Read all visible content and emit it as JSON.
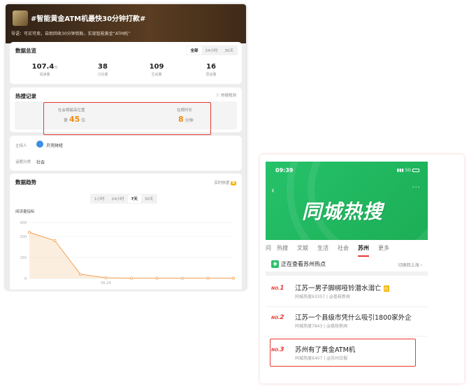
{
  "left_panel": {
    "header": {
      "title": "#智能黄金ATM机最快30分钟打款#",
      "lead": "导语：可买可卖，自助回收30分钟到账，实现智能黄金“ATM机”"
    },
    "overview": {
      "title": "数据总览",
      "ranges": [
        "全部",
        "24小时",
        "30天"
      ],
      "active_range": "全部",
      "stats": [
        {
          "value": "107.4",
          "unit": "万",
          "label": "阅读量"
        },
        {
          "value": "38",
          "unit": "",
          "label": "讨论量"
        },
        {
          "value": "109",
          "unit": "",
          "label": "互动量"
        },
        {
          "value": "16",
          "unit": "",
          "label": "原创量"
        }
      ]
    },
    "hot_record": {
      "title": "热搜记录",
      "rule_link": "热搜规则",
      "position_label": "社会榜最高位置",
      "position_prefix": "第",
      "position_value": "45",
      "position_suffix": "位",
      "duration_label": "在榜时长",
      "duration_value": "8",
      "duration_unit": "分钟"
    },
    "info": {
      "host_label": "主持人",
      "host_name": "贝壳财经",
      "category_label": "话题分类",
      "category_value": "社会"
    },
    "trend": {
      "title": "数据趋势",
      "realtime_label": "实时热度",
      "realtime_value": "0",
      "ranges": [
        "1小时",
        "24小时",
        "7天",
        "30天"
      ],
      "active_range": "7天",
      "metric_label": "阅读量指标",
      "chart_data": {
        "type": "area",
        "ylim": [
          0,
          400
        ],
        "yticks": [
          "400",
          "300",
          "150",
          "0"
        ],
        "x_label": "06-24",
        "values": [
          330,
          270,
          30,
          5,
          2,
          2,
          2,
          2,
          2
        ],
        "color": "#f0a050"
      }
    }
  },
  "right_panel": {
    "status_time": "09:39",
    "status_signal": "5G",
    "banner_title": "同城热搜",
    "back_icon": "back-chevron-icon",
    "more_icon": "more-dots-icon",
    "tabs": [
      "问",
      "热搜",
      "文娱",
      "生活",
      "社会",
      "苏州",
      "更多"
    ],
    "active_tab": "苏州",
    "viewing_text": "正在查看苏州热点",
    "switch_text": "切换回上海",
    "items": [
      {
        "rank": "1",
        "title": "江苏一男子脚绑哑铃潜水溺亡",
        "badge": "热",
        "meta": "同城热度63357 | @荔枝新闻"
      },
      {
        "rank": "2",
        "title": "江苏一个县级市凭什么吸引1800家外企",
        "meta": "同城热度7843 | @荔枝新闻"
      },
      {
        "rank": "3",
        "title": "苏州有了黄金ATM机",
        "meta": "同城热度6407 | @苏州日报"
      }
    ],
    "accent_color": "#e63a33"
  }
}
